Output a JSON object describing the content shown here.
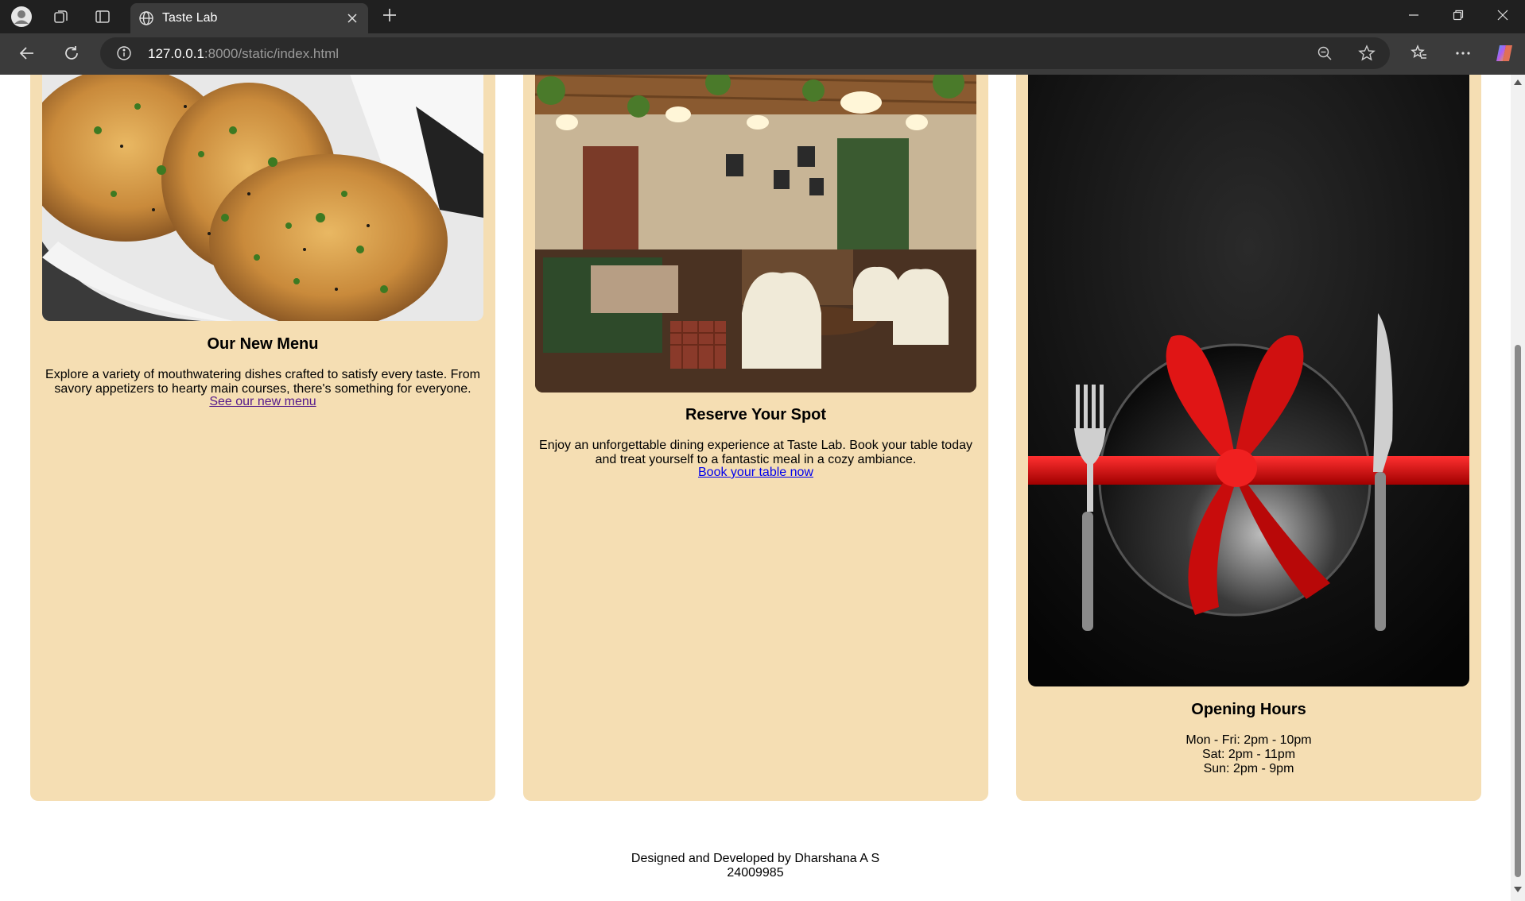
{
  "browser": {
    "tab_title": "Taste Lab",
    "url_host": "127.0.0.1",
    "url_rest": ":8000/static/index.html"
  },
  "icons": {
    "profile": "profile-icon",
    "workspaces": "workspaces-icon",
    "tab_actions": "vertical-tabs-icon",
    "favicon": "globe-icon",
    "close_tab": "close-icon",
    "new_tab": "plus-icon",
    "back": "back-arrow-icon",
    "reload": "reload-icon",
    "site_info": "info-icon",
    "zoom": "zoom-out-icon",
    "favorite": "star-icon",
    "favorites_bar": "favorites-icon",
    "more": "more-icon",
    "copilot": "copilot-icon"
  },
  "cards": [
    {
      "title": "Our New Menu",
      "description": "Explore a variety of mouthwatering dishes crafted to satisfy every taste. From savory appetizers to hearty main courses, there's something for everyone.",
      "link": "See our new menu",
      "image": "garlic-naan-photo"
    },
    {
      "title": "Reserve Your Spot",
      "description": "Enjoy an unforgettable dining experience at Taste Lab. Book your table today and treat yourself to a fantastic meal in a cozy ambiance.",
      "link": "Book your table now",
      "image": "restaurant-interior-photo"
    },
    {
      "title": "Opening Hours",
      "hours": [
        "Mon - Fri: 2pm - 10pm",
        "Sat: 2pm - 11pm",
        "Sun: 2pm - 9pm"
      ],
      "image": "gift-plate-photo"
    }
  ],
  "footer": {
    "credit": "Designed and Developed by Dharshana A S",
    "id": "24009985"
  },
  "colors": {
    "card_bg": "#f5deb3",
    "visited_link": "#551a8b",
    "link": "#0000ee",
    "chrome_dark": "#202020",
    "toolbar": "#3b3b3b"
  }
}
